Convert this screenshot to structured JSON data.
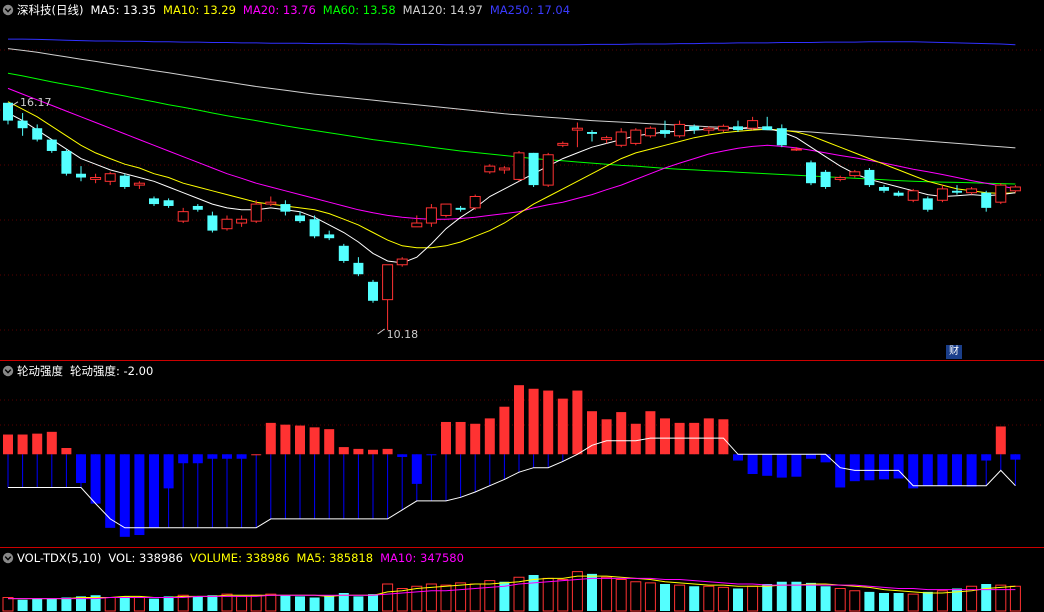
{
  "header": {
    "stock_title": "深科技(日线)",
    "ma5": "MA5: 13.35",
    "ma10": "MA10: 13.29",
    "ma20": "MA20: 13.76",
    "ma60": "MA60: 13.58",
    "ma120": "MA120: 14.97",
    "ma250": "MA250: 17.04"
  },
  "indicator": {
    "name": "轮动强度",
    "value_label": "轮动强度: -2.00"
  },
  "volume_panel": {
    "name": "VOL-TDX(5,10)",
    "vol": "VOL: 338986",
    "volume": "VOLUME: 338986",
    "ma5": "MA5: 385818",
    "ma10": "MA10: 347580"
  },
  "annotations": {
    "high_label": "16.17",
    "low_label": "10.18",
    "flag": "财"
  },
  "colors": {
    "up": "#ff3232",
    "down": "#54ffff",
    "ma5": "#ffffff",
    "ma10": "#ffff00",
    "ma20": "#ff00ff",
    "ma60": "#00ff00",
    "ma120": "#d0d0d0",
    "ma250": "#3030ff",
    "neg_bar": "#0000ff"
  },
  "chart_data": {
    "type": "candlestick",
    "ohlc": [
      [
        16.17,
        16.17,
        15.6,
        15.7
      ],
      [
        15.7,
        15.9,
        15.3,
        15.5
      ],
      [
        15.5,
        15.6,
        15.15,
        15.2
      ],
      [
        15.2,
        15.2,
        14.85,
        14.9
      ],
      [
        14.9,
        14.95,
        14.25,
        14.3
      ],
      [
        14.3,
        14.5,
        14.1,
        14.2
      ],
      [
        14.15,
        14.3,
        14.05,
        14.2
      ],
      [
        14.1,
        14.35,
        14.0,
        14.3
      ],
      [
        14.25,
        14.3,
        13.9,
        13.95
      ],
      [
        14.0,
        14.1,
        13.9,
        14.05
      ],
      [
        13.65,
        13.7,
        13.45,
        13.5
      ],
      [
        13.6,
        13.65,
        13.4,
        13.45
      ],
      [
        13.05,
        13.4,
        13.0,
        13.3
      ],
      [
        13.45,
        13.5,
        13.3,
        13.35
      ],
      [
        13.2,
        13.3,
        12.75,
        12.8
      ],
      [
        12.85,
        13.2,
        12.8,
        13.1
      ],
      [
        13.0,
        13.2,
        12.9,
        13.1
      ],
      [
        13.05,
        13.6,
        13.0,
        13.5
      ],
      [
        13.5,
        13.7,
        13.45,
        13.55
      ],
      [
        13.5,
        13.6,
        13.2,
        13.3
      ],
      [
        13.2,
        13.3,
        13.0,
        13.05
      ],
      [
        13.1,
        13.2,
        12.6,
        12.65
      ],
      [
        12.7,
        12.8,
        12.55,
        12.6
      ],
      [
        12.4,
        12.45,
        11.95,
        12.0
      ],
      [
        11.95,
        12.1,
        11.6,
        11.65
      ],
      [
        11.45,
        11.5,
        10.9,
        10.95
      ],
      [
        10.98,
        11.9,
        10.18,
        11.9
      ],
      [
        11.9,
        12.1,
        11.85,
        12.05
      ],
      [
        12.9,
        13.2,
        12.9,
        13.0
      ],
      [
        13.0,
        13.5,
        12.9,
        13.4
      ],
      [
        13.2,
        13.5,
        13.15,
        13.5
      ],
      [
        13.4,
        13.45,
        13.3,
        13.35
      ],
      [
        13.4,
        13.75,
        13.35,
        13.7
      ],
      [
        14.35,
        14.55,
        14.3,
        14.5
      ],
      [
        14.4,
        14.5,
        14.3,
        14.45
      ],
      [
        14.15,
        14.9,
        14.1,
        14.85
      ],
      [
        14.85,
        14.85,
        13.95,
        14.0
      ],
      [
        14.0,
        14.85,
        13.95,
        14.8
      ],
      [
        15.05,
        15.15,
        15.0,
        15.1
      ],
      [
        15.45,
        15.65,
        15.0,
        15.5
      ],
      [
        15.4,
        15.45,
        15.15,
        15.35
      ],
      [
        15.2,
        15.3,
        15.1,
        15.25
      ],
      [
        15.05,
        15.5,
        15.0,
        15.4
      ],
      [
        15.1,
        15.5,
        15.05,
        15.45
      ],
      [
        15.3,
        15.55,
        15.25,
        15.5
      ],
      [
        15.45,
        15.7,
        15.25,
        15.35
      ],
      [
        15.3,
        15.7,
        15.25,
        15.6
      ],
      [
        15.55,
        15.6,
        15.35,
        15.45
      ],
      [
        15.45,
        15.55,
        15.35,
        15.5
      ],
      [
        15.45,
        15.6,
        15.4,
        15.55
      ],
      [
        15.55,
        15.7,
        15.4,
        15.45
      ],
      [
        15.5,
        15.8,
        15.45,
        15.7
      ],
      [
        15.55,
        15.8,
        15.45,
        15.45
      ],
      [
        15.5,
        15.6,
        15.0,
        15.05
      ],
      [
        14.95,
        15.0,
        14.9,
        14.95
      ],
      [
        14.6,
        14.65,
        14.0,
        14.05
      ],
      [
        14.35,
        14.4,
        13.9,
        13.95
      ],
      [
        14.15,
        14.25,
        14.1,
        14.2
      ],
      [
        14.25,
        14.4,
        14.2,
        14.35
      ],
      [
        14.4,
        14.45,
        13.95,
        14.0
      ],
      [
        13.95,
        14.0,
        13.8,
        13.85
      ],
      [
        13.8,
        13.85,
        13.7,
        13.72
      ],
      [
        13.6,
        13.9,
        13.55,
        13.85
      ],
      [
        13.65,
        13.7,
        13.3,
        13.35
      ],
      [
        13.6,
        14.0,
        13.55,
        13.9
      ],
      [
        13.85,
        14.0,
        13.75,
        13.8
      ],
      [
        13.8,
        13.95,
        13.75,
        13.9
      ],
      [
        13.8,
        13.85,
        13.3,
        13.4
      ],
      [
        13.55,
        14.05,
        13.5,
        14.0
      ],
      [
        13.85,
        14.0,
        13.8,
        13.95
      ]
    ],
    "ma5": [
      15.9,
      15.7,
      15.45,
      15.2,
      14.95,
      14.7,
      14.55,
      14.4,
      14.3,
      14.2,
      14.1,
      13.95,
      13.8,
      13.65,
      13.5,
      13.4,
      13.35,
      13.35,
      13.4,
      13.35,
      13.3,
      13.15,
      12.95,
      12.75,
      12.5,
      12.2,
      12.0,
      11.95,
      12.1,
      12.45,
      12.85,
      13.15,
      13.4,
      13.7,
      13.9,
      14.1,
      14.3,
      14.5,
      14.7,
      14.85,
      15.0,
      15.1,
      15.2,
      15.3,
      15.35,
      15.4,
      15.42,
      15.45,
      15.47,
      15.5,
      15.5,
      15.52,
      15.5,
      15.4,
      15.25,
      15.0,
      14.75,
      14.5,
      14.3,
      14.15,
      14.05,
      13.95,
      13.85,
      13.75,
      13.7,
      13.72,
      13.75,
      13.72,
      13.75,
      13.8
    ],
    "ma10": [
      16.2,
      16.0,
      15.8,
      15.55,
      15.3,
      15.05,
      14.85,
      14.7,
      14.55,
      14.45,
      14.3,
      14.2,
      14.05,
      13.95,
      13.85,
      13.75,
      13.65,
      13.55,
      13.5,
      13.45,
      13.4,
      13.35,
      13.25,
      13.1,
      12.95,
      12.75,
      12.55,
      12.4,
      12.35,
      12.35,
      12.4,
      12.5,
      12.65,
      12.8,
      13.0,
      13.25,
      13.5,
      13.7,
      13.9,
      14.1,
      14.3,
      14.5,
      14.7,
      14.85,
      14.95,
      15.05,
      15.15,
      15.25,
      15.32,
      15.38,
      15.42,
      15.45,
      15.47,
      15.45,
      15.4,
      15.3,
      15.15,
      15.0,
      14.85,
      14.7,
      14.55,
      14.4,
      14.25,
      14.1,
      14.0,
      13.9,
      13.85,
      13.8,
      13.78,
      13.8
    ],
    "ma20": [
      16.55,
      16.4,
      16.25,
      16.1,
      15.95,
      15.8,
      15.65,
      15.5,
      15.35,
      15.2,
      15.05,
      14.9,
      14.75,
      14.6,
      14.45,
      14.3,
      14.18,
      14.05,
      13.95,
      13.85,
      13.75,
      13.65,
      13.55,
      13.45,
      13.35,
      13.27,
      13.2,
      13.15,
      13.12,
      13.1,
      13.1,
      13.12,
      13.15,
      13.2,
      13.25,
      13.3,
      13.4,
      13.48,
      13.55,
      13.65,
      13.75,
      13.88,
      14.0,
      14.15,
      14.3,
      14.45,
      14.58,
      14.7,
      14.82,
      14.9,
      14.97,
      15.02,
      15.05,
      15.02,
      14.98,
      14.92,
      14.85,
      14.78,
      14.72,
      14.65,
      14.58,
      14.5,
      14.42,
      14.35,
      14.28,
      14.2,
      14.12,
      14.05,
      13.98,
      13.9
    ],
    "ma60": [
      16.95,
      16.88,
      16.8,
      16.72,
      16.65,
      16.58,
      16.5,
      16.42,
      16.35,
      16.27,
      16.2,
      16.12,
      16.05,
      15.98,
      15.9,
      15.83,
      15.76,
      15.7,
      15.63,
      15.56,
      15.5,
      15.44,
      15.38,
      15.32,
      15.26,
      15.2,
      15.15,
      15.1,
      15.05,
      15.0,
      14.95,
      14.9,
      14.86,
      14.82,
      14.78,
      14.74,
      14.7,
      14.67,
      14.64,
      14.61,
      14.58,
      14.55,
      14.52,
      14.5,
      14.47,
      14.44,
      14.42,
      14.4,
      14.38,
      14.36,
      14.34,
      14.32,
      14.3,
      14.28,
      14.26,
      14.24,
      14.22,
      14.2,
      14.18,
      14.16,
      14.14,
      14.12,
      14.1,
      14.09,
      14.08,
      14.07,
      14.06,
      14.05,
      14.04,
      14.03
    ],
    "ma120": [
      17.6,
      17.55,
      17.5,
      17.44,
      17.38,
      17.32,
      17.26,
      17.2,
      17.14,
      17.08,
      17.02,
      16.96,
      16.9,
      16.84,
      16.78,
      16.72,
      16.66,
      16.6,
      16.55,
      16.5,
      16.45,
      16.4,
      16.36,
      16.32,
      16.28,
      16.24,
      16.2,
      16.16,
      16.12,
      16.08,
      16.04,
      16.0,
      15.96,
      15.92,
      15.88,
      15.85,
      15.82,
      15.79,
      15.76,
      15.73,
      15.7,
      15.68,
      15.66,
      15.64,
      15.62,
      15.6,
      15.58,
      15.56,
      15.54,
      15.52,
      15.5,
      15.48,
      15.46,
      15.44,
      15.42,
      15.4,
      15.37,
      15.34,
      15.31,
      15.28,
      15.25,
      15.22,
      15.19,
      15.16,
      15.13,
      15.1,
      15.07,
      15.04,
      15.01,
      14.98
    ],
    "ma250": [
      17.85,
      17.85,
      17.84,
      17.83,
      17.82,
      17.81,
      17.8,
      17.8,
      17.79,
      17.79,
      17.78,
      17.78,
      17.77,
      17.77,
      17.76,
      17.76,
      17.75,
      17.75,
      17.74,
      17.74,
      17.74,
      17.73,
      17.73,
      17.73,
      17.72,
      17.72,
      17.72,
      17.71,
      17.71,
      17.71,
      17.7,
      17.7,
      17.7,
      17.7,
      17.7,
      17.7,
      17.7,
      17.7,
      17.7,
      17.7,
      17.71,
      17.71,
      17.71,
      17.72,
      17.72,
      17.72,
      17.73,
      17.73,
      17.74,
      17.74,
      17.75,
      17.75,
      17.75,
      17.76,
      17.76,
      17.76,
      17.77,
      17.77,
      17.77,
      17.78,
      17.78,
      17.78,
      17.78,
      17.77,
      17.76,
      17.75,
      17.74,
      17.73,
      17.72,
      17.7
    ],
    "price_range": [
      9.6,
      18.3
    ],
    "rotation_strength": [
      22,
      22,
      23,
      25,
      7,
      -32,
      -55,
      -82,
      -92,
      -90,
      -82,
      -38,
      -10,
      -10,
      -5,
      -5,
      -5,
      0,
      35,
      33,
      32,
      30,
      28,
      8,
      6,
      5,
      6,
      -3,
      -33,
      -1,
      36,
      36,
      34,
      40,
      53,
      77,
      73,
      71,
      62,
      71,
      48,
      39,
      47,
      34,
      48,
      40,
      35,
      35,
      40,
      39,
      -7,
      -22,
      -24,
      -26,
      -25,
      -5,
      -9,
      -37,
      -30,
      -29,
      -28,
      -27,
      -38,
      -35,
      -35,
      -35,
      -36,
      -7,
      31,
      -6
    ],
    "rotation_line": [
      -37,
      -37,
      -37,
      -37,
      -37,
      -37,
      -55,
      -72,
      -82,
      -82,
      -82,
      -82,
      -82,
      -82,
      -82,
      -82,
      -82,
      -82,
      -72,
      -72,
      -72,
      -72,
      -72,
      -72,
      -72,
      -72,
      -72,
      -62,
      -52,
      -52,
      -52,
      -48,
      -42,
      -35,
      -28,
      -20,
      -15,
      -15,
      -8,
      0,
      10,
      15,
      15,
      15,
      18,
      18,
      18,
      18,
      18,
      18,
      0,
      0,
      0,
      0,
      0,
      0,
      0,
      -15,
      -18,
      -18,
      -18,
      -18,
      -35,
      -35,
      -35,
      -35,
      -35,
      -35,
      -18,
      -35
    ],
    "rotation_range": [
      -100,
      85
    ],
    "volume": [
      12,
      10,
      11,
      11,
      12,
      13,
      14,
      12,
      13,
      12,
      11,
      13,
      14,
      13,
      14,
      15,
      13,
      14,
      15,
      14,
      13,
      12,
      14,
      16,
      13,
      15,
      24,
      20,
      22,
      24,
      23,
      25,
      24,
      27,
      26,
      30,
      32,
      29,
      28,
      35,
      33,
      30,
      28,
      26,
      25,
      24,
      23,
      22,
      22,
      21,
      20,
      22,
      24,
      26,
      26,
      25,
      22,
      20,
      18,
      17,
      16,
      16,
      15,
      17,
      18,
      20,
      22,
      24,
      23,
      22
    ],
    "volume_up": [
      true,
      false,
      false,
      false,
      false,
      false,
      false,
      true,
      false,
      true,
      false,
      false,
      true,
      false,
      false,
      true,
      true,
      true,
      true,
      false,
      false,
      false,
      false,
      false,
      false,
      false,
      true,
      true,
      true,
      true,
      true,
      true,
      true,
      true,
      false,
      true,
      false,
      true,
      true,
      true,
      false,
      true,
      true,
      true,
      true,
      false,
      true,
      false,
      true,
      true,
      false,
      true,
      false,
      false,
      false,
      false,
      false,
      true,
      true,
      false,
      false,
      false,
      true,
      false,
      true,
      false,
      true,
      false,
      true,
      true
    ],
    "vol_ma5": [
      11,
      11,
      11,
      11,
      11,
      12,
      12,
      12,
      13,
      13,
      12,
      12,
      13,
      13,
      13,
      14,
      14,
      14,
      14,
      14,
      14,
      14,
      13,
      14,
      14,
      14,
      17,
      18,
      20,
      21,
      22,
      23,
      24,
      24,
      25,
      26,
      28,
      29,
      29,
      31,
      31,
      31,
      30,
      29,
      28,
      26,
      25,
      24,
      23,
      23,
      22,
      22,
      22,
      23,
      23,
      24,
      24,
      23,
      22,
      21,
      19,
      18,
      17,
      16,
      16,
      17,
      18,
      20,
      21,
      22
    ],
    "vol_ma10": [
      11,
      11,
      11,
      11,
      11,
      11,
      11,
      12,
      12,
      12,
      12,
      12,
      12,
      13,
      13,
      13,
      13,
      13,
      14,
      14,
      14,
      14,
      14,
      14,
      14,
      14,
      15,
      16,
      17,
      18,
      18,
      19,
      20,
      21,
      22,
      24,
      25,
      26,
      27,
      28,
      29,
      29,
      29,
      29,
      29,
      28,
      28,
      27,
      26,
      25,
      24,
      24,
      23,
      23,
      23,
      23,
      23,
      23,
      23,
      22,
      21,
      20,
      20,
      19,
      19,
      19,
      19,
      19,
      19,
      19
    ],
    "volume_range": [
      0,
      40
    ],
    "high_annot_index": 0,
    "low_annot_index": 26
  }
}
